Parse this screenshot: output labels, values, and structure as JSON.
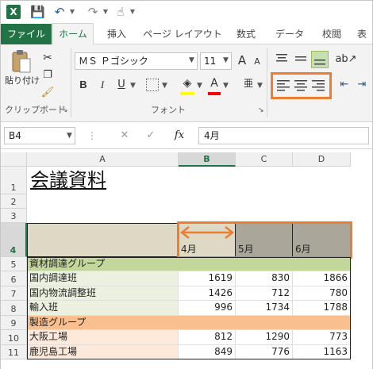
{
  "app": {
    "logo": "X",
    "icon": "excel-icon"
  },
  "qat": {
    "save": "💾",
    "undo": "↶",
    "redo": "↷",
    "touch": "☝"
  },
  "tabs": [
    "ファイル",
    "ホーム",
    "挿入",
    "ページ レイアウト",
    "数式",
    "データ",
    "校閲",
    "表"
  ],
  "ribbon": {
    "paste_label": "貼り付け",
    "clipboard_label": "クリップボード",
    "font_name": "ＭＳ Ｐゴシック",
    "font_size": "11",
    "grow_font": "A",
    "shrink_font": "A",
    "bold": "B",
    "italic": "I",
    "underline": "U",
    "font_group_label": "フォント",
    "phonetic": "亜"
  },
  "formula_bar": {
    "name_box": "B4",
    "cancel": "✕",
    "enter": "✓",
    "fx": "fx",
    "value": "4月"
  },
  "columns": [
    "A",
    "B",
    "C",
    "D"
  ],
  "selected_column": "B",
  "rows": [
    "1",
    "2",
    "3",
    "4",
    "5",
    "6",
    "7",
    "8",
    "9",
    "10",
    "11"
  ],
  "selected_row": "4",
  "sheet": {
    "title": "会議資料",
    "header": [
      "",
      "4月",
      "5月",
      "6月"
    ],
    "groups": [
      {
        "name": "資材調達グループ",
        "items": [
          {
            "label": "国内調達班",
            "values": [
              "1619",
              "830",
              "1866"
            ]
          },
          {
            "label": "国内物流調整班",
            "values": [
              "1426",
              "712",
              "780"
            ]
          },
          {
            "label": "輸入班",
            "values": [
              "996",
              "1734",
              "1788"
            ]
          }
        ]
      },
      {
        "name": "製造グループ",
        "items": [
          {
            "label": "大阪工場",
            "values": [
              "812",
              "1290",
              "773"
            ]
          },
          {
            "label": "鹿児島工場",
            "values": [
              "849",
              "776",
              "1163"
            ]
          }
        ]
      }
    ]
  },
  "colors": {
    "accent": "#217346",
    "highlight": "#ed7d31",
    "header_fill": "#ddd9c4",
    "group1": "#c4d79b",
    "group1_rows": "#ebf1de",
    "group2": "#fabf8f",
    "group2_rows": "#fde9d9"
  }
}
